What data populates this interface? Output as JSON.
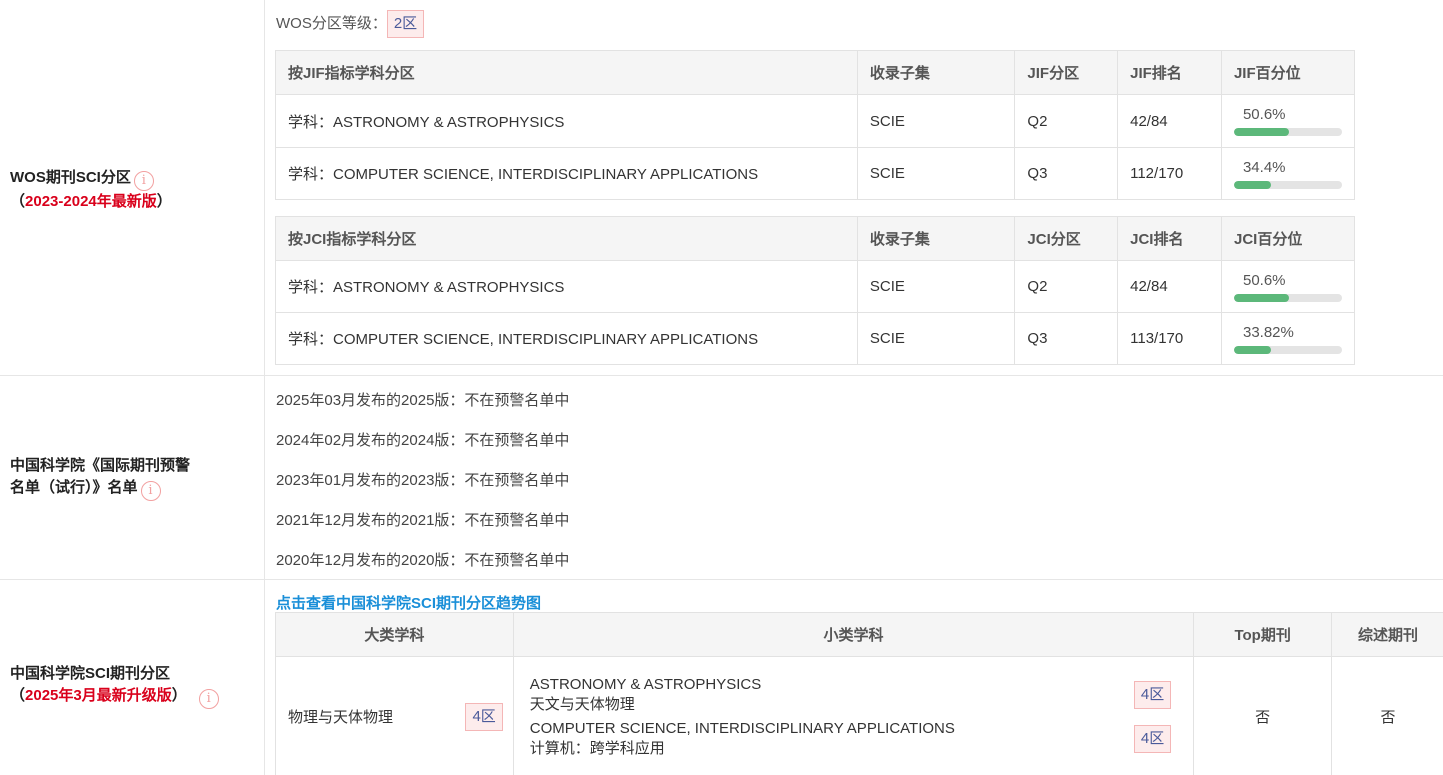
{
  "wos": {
    "label": "WOS期刊SCI分区",
    "edition_prefix": "（",
    "edition": "2023-2024年最新版",
    "edition_suffix": "）",
    "level_label": "WOS分区等级：",
    "level_value": "2区",
    "jif_table": {
      "headers": [
        "按JIF指标学科分区",
        "收录子集",
        "JIF分区",
        "JIF排名",
        "JIF百分位"
      ],
      "rows": [
        {
          "subject": "学科：ASTRONOMY & ASTROPHYSICS",
          "collection": "SCIE",
          "quartile": "Q2",
          "rank": "42/84",
          "percentile": "50.6%",
          "fill": 0.506
        },
        {
          "subject": "学科：COMPUTER SCIENCE, INTERDISCIPLINARY APPLICATIONS",
          "collection": "SCIE",
          "quartile": "Q3",
          "rank": "112/170",
          "percentile": "34.4%",
          "fill": 0.344
        }
      ]
    },
    "jci_table": {
      "headers": [
        "按JCI指标学科分区",
        "收录子集",
        "JCI分区",
        "JCI排名",
        "JCI百分位"
      ],
      "rows": [
        {
          "subject": "学科：ASTRONOMY & ASTROPHYSICS",
          "collection": "SCIE",
          "quartile": "Q2",
          "rank": "42/84",
          "percentile": "50.6%",
          "fill": 0.506
        },
        {
          "subject": "学科：COMPUTER SCIENCE, INTERDISCIPLINARY APPLICATIONS",
          "collection": "SCIE",
          "quartile": "Q3",
          "rank": "113/170",
          "percentile": "33.82%",
          "fill": 0.3382
        }
      ]
    }
  },
  "warning": {
    "label_line1": "中国科学院《国际期刊预警",
    "label_line2": "名单（试行）》名单",
    "lines": [
      "2025年03月发布的2025版：不在预警名单中",
      "2024年02月发布的2024版：不在预警名单中",
      "2023年01月发布的2023版：不在预警名单中",
      "2021年12月发布的2021版：不在预警名单中",
      "2020年12月发布的2020版：不在预警名单中"
    ]
  },
  "cas": {
    "label": "中国科学院SCI期刊分区",
    "edition_prefix": "（",
    "edition": "2025年3月最新升级版",
    "edition_suffix": "）",
    "trend_link": "点击查看中国科学院SCI期刊分区趋势图",
    "headers": [
      "大类学科",
      "小类学科",
      "Top期刊",
      "综述期刊"
    ],
    "major": "物理与天体物理",
    "major_zone": "4区",
    "subs": [
      {
        "name_en": "ASTRONOMY & ASTROPHYSICS",
        "name_cn": "天文与天体物理",
        "zone": "4区"
      },
      {
        "name_en": "COMPUTER SCIENCE, INTERDISCIPLINARY APPLICATIONS",
        "name_cn": "计算机：跨学科应用",
        "zone": "4区"
      }
    ],
    "top": "否",
    "review": "否"
  },
  "colors": {
    "accent_red": "#d9001b",
    "link_blue": "#1a8fd8",
    "bar_green": "#5cb87a"
  }
}
